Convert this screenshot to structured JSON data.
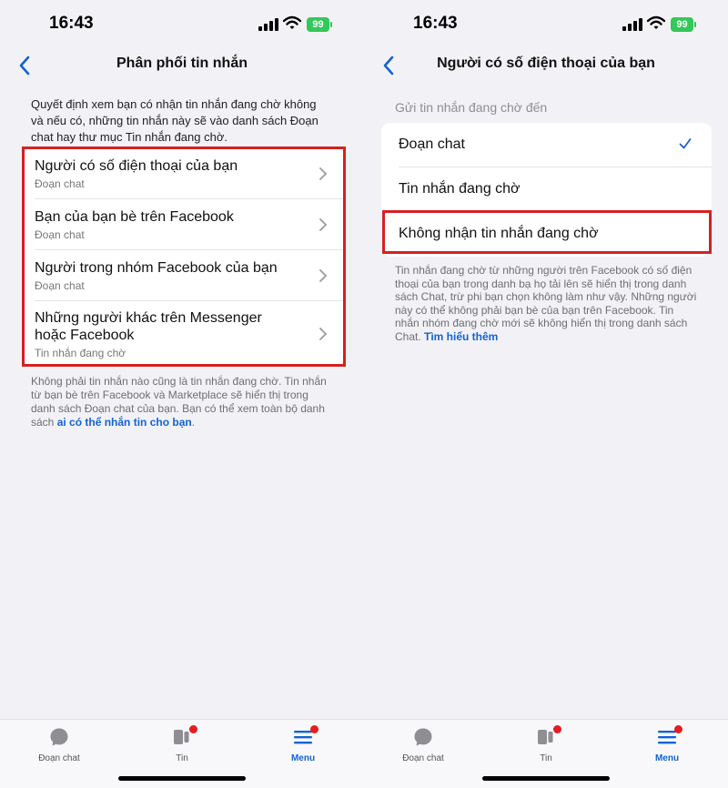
{
  "status_bar": {
    "time": "16:43",
    "battery": "99"
  },
  "left_screen": {
    "title": "Phân phối tin nhắn",
    "description": "Quyết định xem bạn có nhận tin nhắn đang chờ không và nếu có, những tin nhắn này sẽ vào danh sách Đoạn chat hay thư mục Tin nhắn đang chờ.",
    "items": [
      {
        "title": "Người có số điện thoại của bạn",
        "subtitle": "Đoạn chat"
      },
      {
        "title": "Bạn của bạn bè trên Facebook",
        "subtitle": "Đoạn chat"
      },
      {
        "title": "Người trong nhóm Facebook của bạn",
        "subtitle": "Đoạn chat"
      },
      {
        "title": "Những người khác trên Messenger hoặc Facebook",
        "subtitle": "Tin nhắn đang chờ"
      }
    ],
    "footer_text": "Không phải tin nhắn nào cũng là tin nhắn đang chờ. Tin nhắn từ bạn bè trên Facebook và Marketplace sẽ hiển thị trong danh sách Đoạn chat của bạn. Bạn có thể xem toàn bộ danh sách ",
    "footer_link": "ai có thể nhắn tin cho bạn",
    "footer_end": "."
  },
  "right_screen": {
    "title": "Người có số điện thoại của bạn",
    "section_header": "Gửi tin nhắn đang chờ đến",
    "options": [
      {
        "label": "Đoạn chat",
        "selected": true
      },
      {
        "label": "Tin nhắn đang chờ",
        "selected": false
      },
      {
        "label": "Không nhận tin nhắn đang chờ",
        "selected": false
      }
    ],
    "note": "Tin nhắn đang chờ từ những người trên Facebook có số điện thoại của bạn trong danh bạ họ tải lên sẽ hiển thị trong danh sách Chat, trừ phi bạn chọn không làm như vậy. Những người này có thể không phải bạn bè của bạn trên Facebook. Tin nhắn nhóm đang chờ mới sẽ không hiển thị trong danh sách Chat. ",
    "note_link": "Tìm hiểu thêm"
  },
  "tab_bar": {
    "tabs": [
      {
        "label": "Đoạn chat",
        "icon": "chat-bubble-icon",
        "badge": false,
        "active": false
      },
      {
        "label": "Tin",
        "icon": "stories-icon",
        "badge": true,
        "active": false
      },
      {
        "label": "Menu",
        "icon": "menu-icon",
        "badge": true,
        "active": true
      }
    ]
  },
  "colors": {
    "highlight": "#d62020",
    "link": "#1462d3",
    "badge": "#e41e1e",
    "battery": "#34c759"
  }
}
